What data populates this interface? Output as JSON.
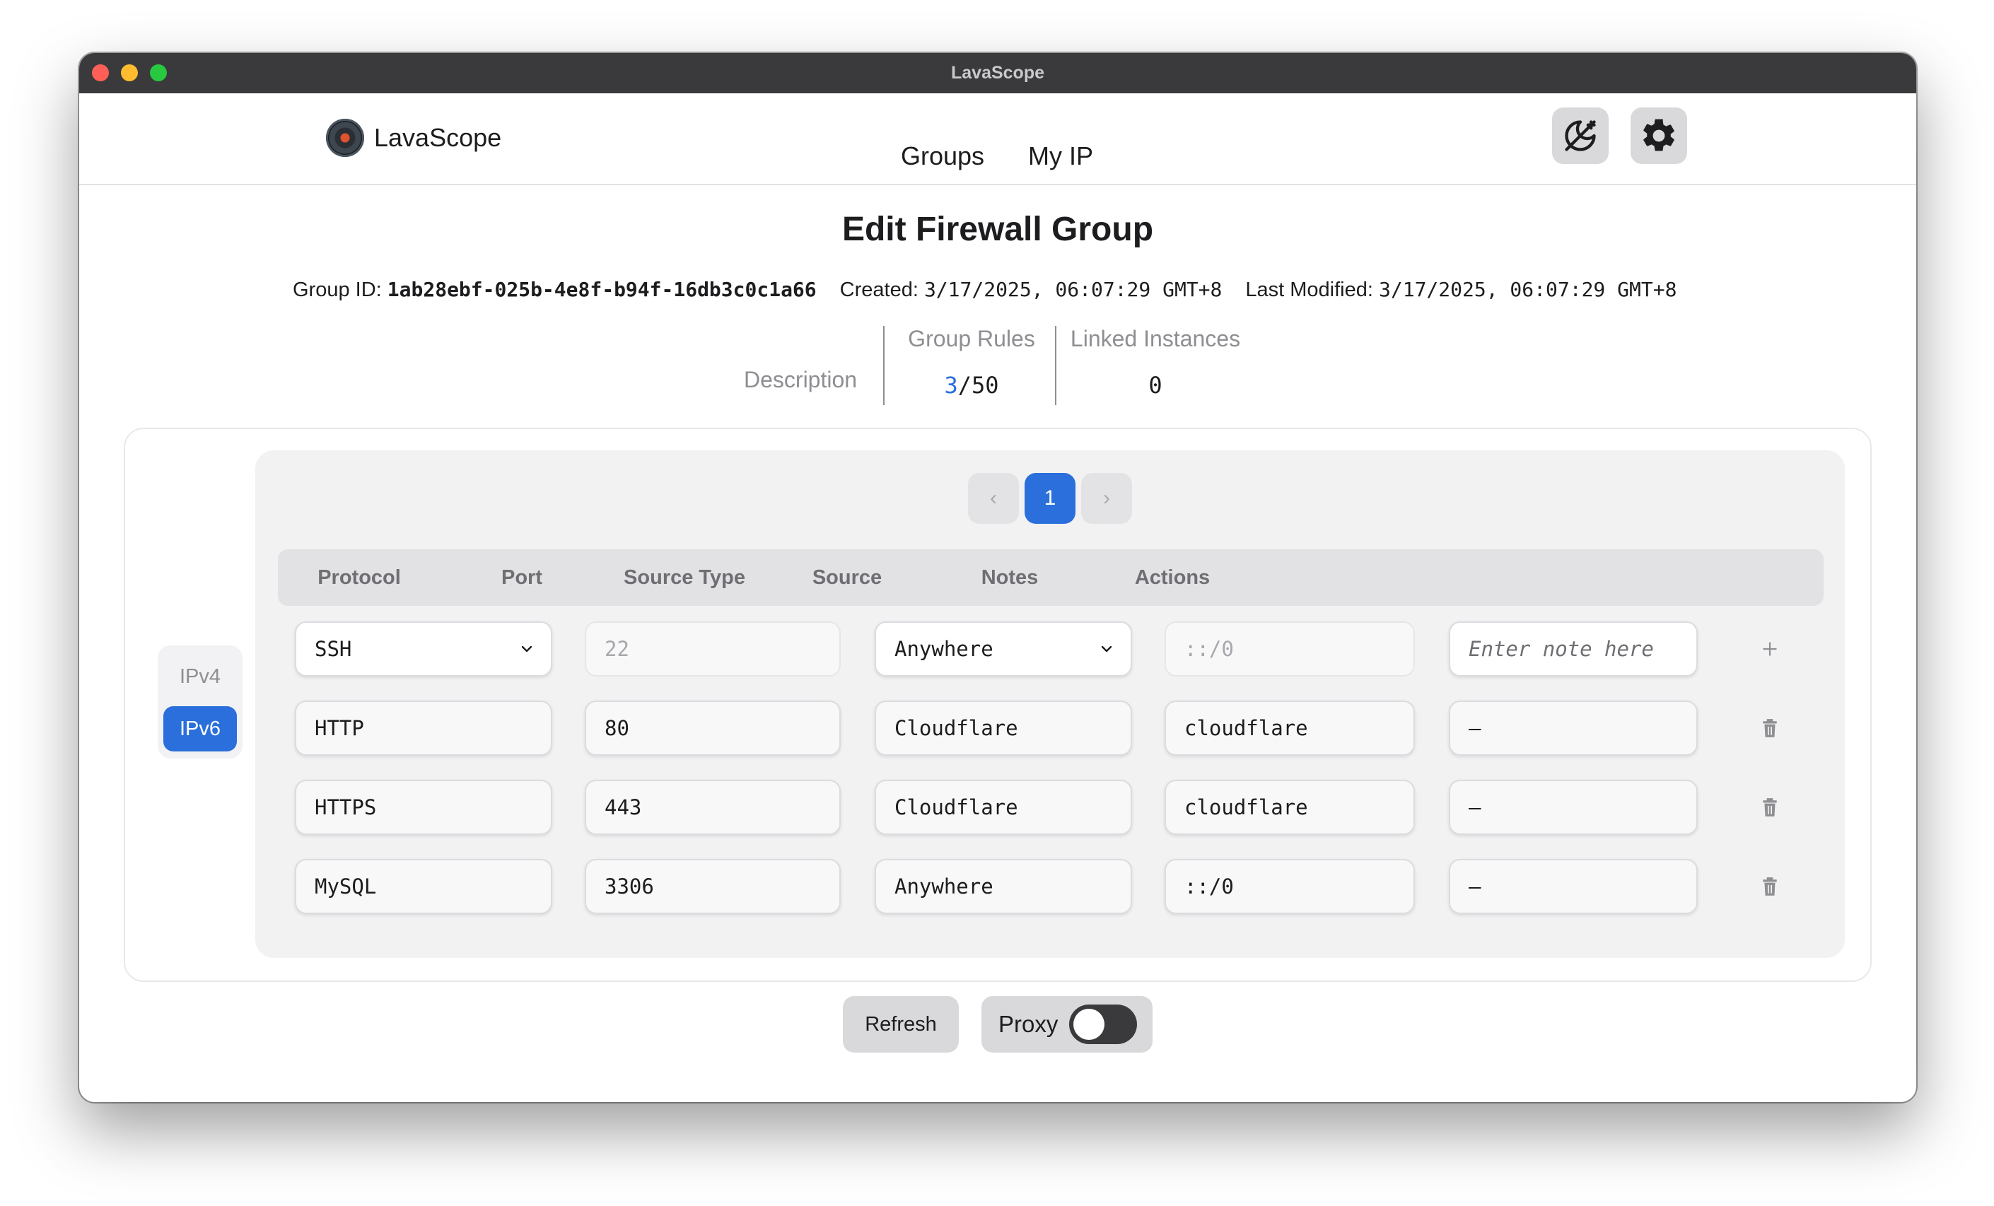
{
  "window": {
    "title": "LavaScope"
  },
  "navbar": {
    "brand": "LavaScope",
    "links": [
      "Groups",
      "My IP"
    ],
    "icons": [
      "theme-toggle-icon",
      "gear-icon"
    ]
  },
  "page": {
    "title": "Edit Firewall Group",
    "group_id_label": "Group ID:",
    "group_id": "1ab28ebf-025b-4e8f-b94f-16db3c0c1a66",
    "created_label": "Created:",
    "created": "3/17/2025, 06:07:29 GMT+8",
    "modified_label": "Last Modified:",
    "modified": "3/17/2025, 06:07:29 GMT+8"
  },
  "stats": {
    "description_label": "Description",
    "rules_label": "Group Rules",
    "rules_count": "3",
    "rules_max": "/50",
    "instances_label": "Linked Instances",
    "instances_count": "0"
  },
  "ip_toggle": {
    "v4": "IPv4",
    "v6": "IPv6",
    "selected": "IPv6"
  },
  "pagination": {
    "prev": "‹",
    "page": "1",
    "next": "›"
  },
  "table": {
    "headers": [
      "Protocol",
      "Port",
      "Source Type",
      "Source",
      "Notes",
      "Actions"
    ],
    "new_rule": {
      "protocol": "SSH",
      "port_placeholder": "22",
      "source_type": "Anywhere",
      "source_placeholder": "::/0",
      "notes_placeholder": "Enter note here",
      "action": "+"
    },
    "rows": [
      {
        "protocol": "HTTP",
        "port": "80",
        "source_type": "Cloudflare",
        "source": "cloudflare",
        "notes": "–"
      },
      {
        "protocol": "HTTPS",
        "port": "443",
        "source_type": "Cloudflare",
        "source": "cloudflare",
        "notes": "–"
      },
      {
        "protocol": "MySQL",
        "port": "3306",
        "source_type": "Anywhere",
        "source": "::/0",
        "notes": "–"
      }
    ]
  },
  "footer": {
    "refresh": "Refresh",
    "proxy": "Proxy",
    "proxy_enabled": false
  },
  "colors": {
    "accent": "#2a6fdb",
    "titlebar": "#3a3a3c"
  }
}
